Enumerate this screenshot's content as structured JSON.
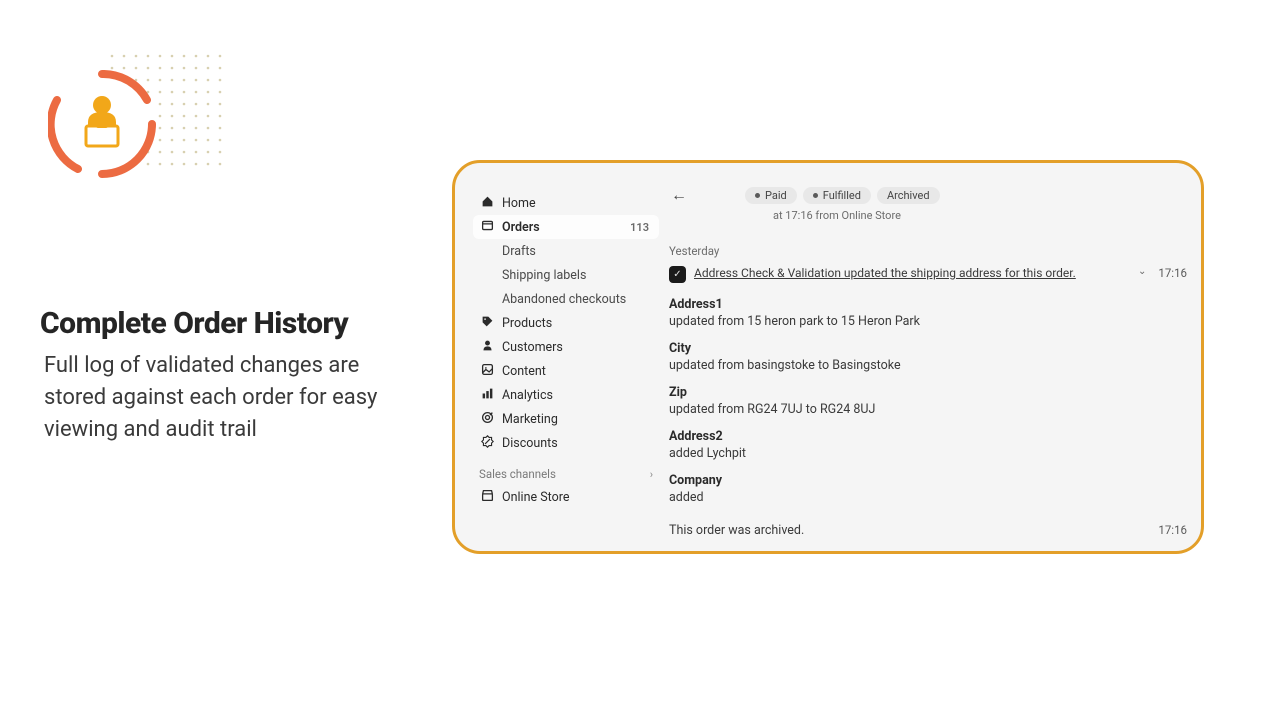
{
  "marketing": {
    "headline": "Complete Order History",
    "subtext": "Full log of validated changes are stored against each order for easy viewing and audit trail"
  },
  "sidebar": {
    "items": [
      {
        "icon": "home",
        "label": "Home"
      },
      {
        "icon": "orders",
        "label": "Orders",
        "badge": "113",
        "active": true
      },
      {
        "sub": true,
        "label": "Drafts"
      },
      {
        "sub": true,
        "label": "Shipping labels"
      },
      {
        "sub": true,
        "label": "Abandoned checkouts"
      },
      {
        "icon": "tag",
        "label": "Products"
      },
      {
        "icon": "person",
        "label": "Customers"
      },
      {
        "icon": "content",
        "label": "Content"
      },
      {
        "icon": "analytics",
        "label": "Analytics"
      },
      {
        "icon": "marketing",
        "label": "Marketing"
      },
      {
        "icon": "discount",
        "label": "Discounts"
      }
    ],
    "channels_label": "Sales channels",
    "online_store": "Online Store"
  },
  "order": {
    "pills": [
      "Paid",
      "Fulfilled",
      "Archived"
    ],
    "sub": "at 17:16 from Online Store",
    "day": "Yesterday",
    "event": {
      "text": "Address Check & Validation updated the shipping address for this order.",
      "time": "17:16"
    },
    "changes": [
      {
        "label": "Address1",
        "desc": "updated from 15 heron park to 15 Heron Park"
      },
      {
        "label": "City",
        "desc": "updated from basingstoke to Basingstoke"
      },
      {
        "label": "Zip",
        "desc": "updated from RG24 7UJ to RG24 8UJ"
      },
      {
        "label": "Address2",
        "desc": "added Lychpit"
      },
      {
        "label": "Company",
        "desc": "added"
      }
    ],
    "archived": {
      "text": "This order was archived.",
      "time": "17:16"
    }
  }
}
